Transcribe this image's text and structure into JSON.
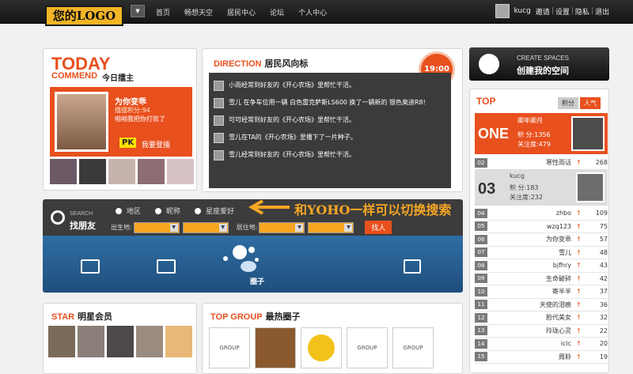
{
  "header": {
    "logo": "您的LOGO",
    "nav_dropdown_icon": "▼",
    "nav": [
      "首页",
      "畅想天空",
      "居民中心",
      "论坛",
      "个人中心"
    ],
    "user": {
      "name": "kucg",
      "links": [
        "邀请",
        "设置",
        "隐私",
        "退出"
      ]
    }
  },
  "today": {
    "title": "TODAY",
    "subtitle": "COMMEND",
    "subtitle2": "今日擂主",
    "name": "为你变乖",
    "points": "擂擂积分:94",
    "message": "啪啪我把你打败了",
    "pk": "PK",
    "pk_label": "我要登擂"
  },
  "direction": {
    "title_en": "DIRECTION",
    "title_cn": "居民风向标",
    "time": "19:00",
    "items": [
      "小雨经常到好友的《开心农场》里帮忙干活。",
      "雪儿 在争车位用一辆 白色雷克萨斯LS600 换了一辆新的 银色奥迪R8!",
      "可可经常到好友的《开心农场》里帮忙干活。",
      "雪儿在TA的《开心农场》里播下了一片种子。",
      "雪儿经常到好友的《开心农场》里帮忙干活。"
    ]
  },
  "create_space": {
    "line1": "CREATE SPACES",
    "line2": "创建我的空间"
  },
  "top": {
    "title": "TOP",
    "tabs": [
      "积分",
      "人气"
    ],
    "first": {
      "label": "ONE",
      "name": "卿年卿月",
      "points": "积 分:1356",
      "attention": "关注度:479"
    },
    "second": {
      "rank": "02",
      "name": "寒性雨话",
      "score": "268"
    },
    "third": {
      "rank": "03",
      "name": "kucg",
      "points": "积 分:183",
      "attention": "关注度:232"
    },
    "list": [
      {
        "rank": "04",
        "name": "zhbo",
        "score": "109"
      },
      {
        "rank": "05",
        "name": "wzq123",
        "score": "75"
      },
      {
        "rank": "06",
        "name": "为你变乖",
        "score": "57"
      },
      {
        "rank": "07",
        "name": "雪儿",
        "score": "48"
      },
      {
        "rank": "08",
        "name": "bjfhry",
        "score": "43"
      },
      {
        "rank": "09",
        "name": "生命破碎",
        "score": "42"
      },
      {
        "rank": "10",
        "name": "寄半半",
        "score": "37"
      },
      {
        "rank": "11",
        "name": "天使的泪痕",
        "score": "36"
      },
      {
        "rank": "12",
        "name": "脸代美女",
        "score": "32"
      },
      {
        "rank": "13",
        "name": "玲珑心灵",
        "score": "22"
      },
      {
        "rank": "14",
        "name": "icic",
        "score": "20"
      },
      {
        "rank": "15",
        "name": "周聆",
        "score": "19"
      }
    ]
  },
  "search": {
    "en": "SEARCH",
    "cn": "找朋友",
    "radios": [
      "地区",
      "昵称",
      "星座爱好"
    ],
    "birth_label": "出生地:",
    "residence_label": "居住地:",
    "button": "找人",
    "annotation": "和YOHO一样可以切换搜索"
  },
  "strip": {
    "circle_label": "圈子"
  },
  "star": {
    "title_en": "STAR",
    "title_cn": "明星会员"
  },
  "group": {
    "title_en": "TOP GROUP",
    "title_cn": "最热圈子",
    "thumb_text": "GROUP"
  },
  "colors": {
    "accent": "#e8501e",
    "dark": "#3b3b3b",
    "blue": "#2a5f92",
    "gold": "#f6a623"
  }
}
